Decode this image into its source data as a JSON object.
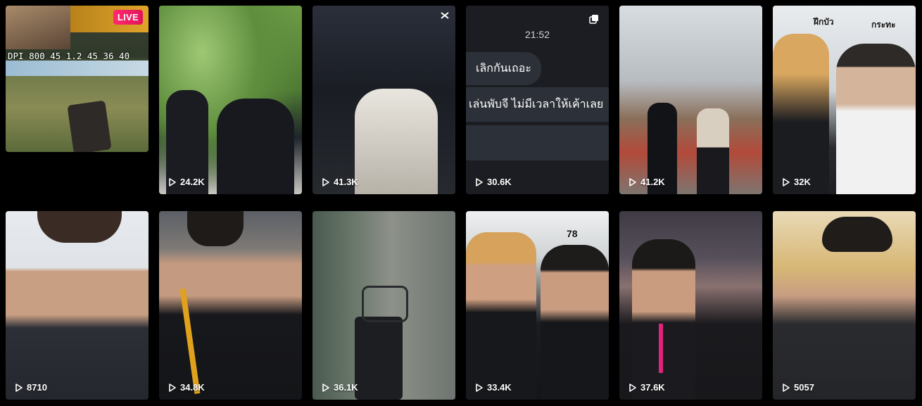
{
  "live_tile": {
    "badge": "LIVE",
    "overlay": "DPI 800 45 1.2 45 36 40"
  },
  "tiles_row1": [
    {
      "views": "24.2K"
    },
    {
      "views": "41.3K"
    },
    {
      "views": "30.6K",
      "chat": {
        "time": "21:52",
        "line1": "เลิกกันเถอะ",
        "line2": "เล่นพับจี ไม่มีเวลาให้เค้าเลย"
      }
    },
    {
      "views": "41.2K"
    },
    {
      "views": "32K",
      "overlay_left": "ฝึกบัว",
      "overlay_right": "กระทะ"
    }
  ],
  "tiles_row2": [
    {
      "views": "8710"
    },
    {
      "views": "34.8K"
    },
    {
      "views": "36.1K"
    },
    {
      "views": "33.4K",
      "overlay_num": "78"
    },
    {
      "views": "37.6K"
    },
    {
      "views": "5057"
    }
  ],
  "colors": {
    "live_badge": "#ff2a6d",
    "chat_bubble": "#2c3038",
    "background": "#000000"
  }
}
